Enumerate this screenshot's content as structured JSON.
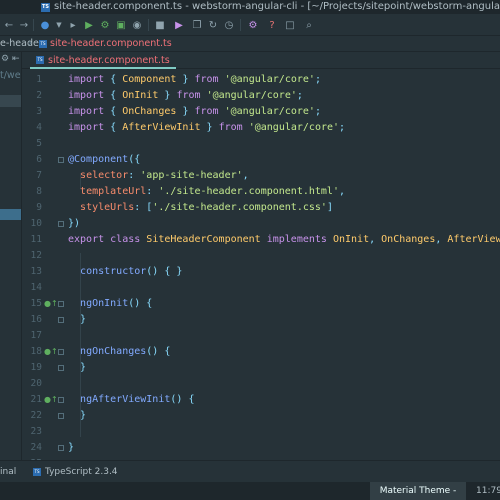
{
  "window": {
    "title": "site-header.component.ts - webstorm-angular-cli - [~/Projects/sitepoint/webstorm-angular-cli]",
    "file_icon": "TS"
  },
  "toolbar": {
    "icons": [
      "back-arrow-icon",
      "forward-arrow-icon",
      "ts-component-icon",
      "dropdown-icon",
      "run-config-icon",
      "run-icon",
      "debug-icon",
      "coverage-icon",
      "profile-icon",
      "stop-icon",
      "sdk-icon",
      "settings-icon",
      "help-icon",
      "version-control-icon",
      "search-icon"
    ]
  },
  "navbar": {
    "crumb1": "e-header",
    "crumb2": "site-header.component.ts"
  },
  "left_panel": {
    "path": "t/web"
  },
  "tabs": [
    {
      "label": "site-header.component.ts",
      "active": true
    }
  ],
  "editor": {
    "lines": [
      {
        "n": "1",
        "tokens": [
          [
            "kw",
            "import"
          ],
          [
            "pl",
            " "
          ],
          [
            "pu",
            "{"
          ],
          [
            "pl",
            " "
          ],
          [
            "ty",
            "Component"
          ],
          [
            "pl",
            " "
          ],
          [
            "pu",
            "}"
          ],
          [
            "pl",
            " "
          ],
          [
            "kw",
            "from"
          ],
          [
            "pl",
            " "
          ],
          [
            "st",
            "'@angular/core'"
          ],
          [
            "pu",
            ";"
          ]
        ]
      },
      {
        "n": "2",
        "tokens": [
          [
            "kw",
            "import"
          ],
          [
            "pl",
            " "
          ],
          [
            "pu",
            "{"
          ],
          [
            "pl",
            " "
          ],
          [
            "ty",
            "OnInit"
          ],
          [
            "pl",
            " "
          ],
          [
            "pu",
            "}"
          ],
          [
            "pl",
            " "
          ],
          [
            "kw",
            "from"
          ],
          [
            "pl",
            " "
          ],
          [
            "st",
            "'@angular/core'"
          ],
          [
            "pu",
            ";"
          ]
        ]
      },
      {
        "n": "3",
        "tokens": [
          [
            "kw",
            "import"
          ],
          [
            "pl",
            " "
          ],
          [
            "pu",
            "{"
          ],
          [
            "pl",
            " "
          ],
          [
            "ty",
            "OnChanges"
          ],
          [
            "pl",
            " "
          ],
          [
            "pu",
            "}"
          ],
          [
            "pl",
            " "
          ],
          [
            "kw",
            "from"
          ],
          [
            "pl",
            " "
          ],
          [
            "st",
            "'@angular/core'"
          ],
          [
            "pu",
            ";"
          ]
        ]
      },
      {
        "n": "4",
        "tokens": [
          [
            "kw",
            "import"
          ],
          [
            "pl",
            " "
          ],
          [
            "pu",
            "{"
          ],
          [
            "pl",
            " "
          ],
          [
            "ty",
            "AfterViewInit"
          ],
          [
            "pl",
            " "
          ],
          [
            "pu",
            "}"
          ],
          [
            "pl",
            " "
          ],
          [
            "kw",
            "from"
          ],
          [
            "pl",
            " "
          ],
          [
            "st",
            "'@angular/core'"
          ],
          [
            "pu",
            ";"
          ]
        ]
      },
      {
        "n": "5",
        "tokens": []
      },
      {
        "n": "6",
        "tokens": [
          [
            "dc",
            "@Component"
          ],
          [
            "pu",
            "({"
          ]
        ]
      },
      {
        "n": "7",
        "tokens": [
          [
            "pl",
            "  "
          ],
          [
            "pr",
            "selector"
          ],
          [
            "pu",
            ":"
          ],
          [
            "pl",
            " "
          ],
          [
            "st",
            "'app-site-header'"
          ],
          [
            "pu",
            ","
          ]
        ]
      },
      {
        "n": "8",
        "tokens": [
          [
            "pl",
            "  "
          ],
          [
            "pr",
            "templateUrl"
          ],
          [
            "pu",
            ":"
          ],
          [
            "pl",
            " "
          ],
          [
            "st",
            "'./site-header.component.html'"
          ],
          [
            "pu",
            ","
          ]
        ]
      },
      {
        "n": "9",
        "tokens": [
          [
            "pl",
            "  "
          ],
          [
            "pr",
            "styleUrls"
          ],
          [
            "pu",
            ":"
          ],
          [
            "pl",
            " "
          ],
          [
            "pu",
            "["
          ],
          [
            "st",
            "'./site-header.component.css'"
          ],
          [
            "pu",
            "]"
          ]
        ]
      },
      {
        "n": "10",
        "tokens": [
          [
            "pu",
            "})"
          ]
        ]
      },
      {
        "n": "11",
        "tokens": [
          [
            "kw",
            "export"
          ],
          [
            "pl",
            " "
          ],
          [
            "kw",
            "class"
          ],
          [
            "pl",
            " "
          ],
          [
            "ty",
            "SiteHeaderComponent"
          ],
          [
            "pl",
            " "
          ],
          [
            "kw",
            "implements"
          ],
          [
            "pl",
            " "
          ],
          [
            "ty",
            "OnInit"
          ],
          [
            "pu",
            ","
          ],
          [
            "pl",
            " "
          ],
          [
            "ty",
            "OnChanges"
          ],
          [
            "pu",
            ","
          ],
          [
            "pl",
            " "
          ],
          [
            "ty",
            "AfterViewInit"
          ],
          [
            "pl",
            " "
          ],
          [
            "pu",
            "{"
          ]
        ]
      },
      {
        "n": "12",
        "tokens": []
      },
      {
        "n": "13",
        "tokens": [
          [
            "pl",
            "  "
          ],
          [
            "fn",
            "constructor"
          ],
          [
            "pu",
            "()"
          ],
          [
            "pl",
            " "
          ],
          [
            "pu",
            "{"
          ],
          [
            "pl",
            " "
          ],
          [
            "pu",
            "}"
          ]
        ]
      },
      {
        "n": "14",
        "tokens": []
      },
      {
        "n": "15",
        "tokens": [
          [
            "pl",
            "  "
          ],
          [
            "fn",
            "ngOnInit"
          ],
          [
            "pu",
            "()"
          ],
          [
            "pl",
            " "
          ],
          [
            "pu",
            "{"
          ]
        ]
      },
      {
        "n": "16",
        "tokens": [
          [
            "pl",
            "  "
          ],
          [
            "pu",
            "}"
          ]
        ]
      },
      {
        "n": "17",
        "tokens": []
      },
      {
        "n": "18",
        "tokens": [
          [
            "pl",
            "  "
          ],
          [
            "fn",
            "ngOnChanges"
          ],
          [
            "pu",
            "()"
          ],
          [
            "pl",
            " "
          ],
          [
            "pu",
            "{"
          ]
        ]
      },
      {
        "n": "19",
        "tokens": [
          [
            "pl",
            "  "
          ],
          [
            "pu",
            "}"
          ]
        ]
      },
      {
        "n": "20",
        "tokens": []
      },
      {
        "n": "21",
        "tokens": [
          [
            "pl",
            "  "
          ],
          [
            "fn",
            "ngAfterViewInit"
          ],
          [
            "pu",
            "()"
          ],
          [
            "pl",
            " "
          ],
          [
            "pu",
            "{"
          ]
        ]
      },
      {
        "n": "22",
        "tokens": [
          [
            "pl",
            "  "
          ],
          [
            "pu",
            "}"
          ]
        ]
      },
      {
        "n": "23",
        "tokens": []
      },
      {
        "n": "24",
        "tokens": [
          [
            "pu",
            "}"
          ]
        ]
      },
      {
        "n": "25",
        "tokens": []
      }
    ],
    "gutter_marks": [
      "15",
      "18",
      "21"
    ]
  },
  "bottom_tools": {
    "terminal": "inal",
    "ts_icon": "TS",
    "ts_version": "TypeScript 2.3.4"
  },
  "status": {
    "theme": "Material Theme - Default",
    "position": "11:79"
  },
  "colors": {
    "keyword": "#c792ea",
    "string": "#c3e88d",
    "type": "#ffcb6b",
    "function": "#82aaff",
    "punctuation": "#89ddff",
    "property": "#f78c6c",
    "background": "#263238"
  }
}
